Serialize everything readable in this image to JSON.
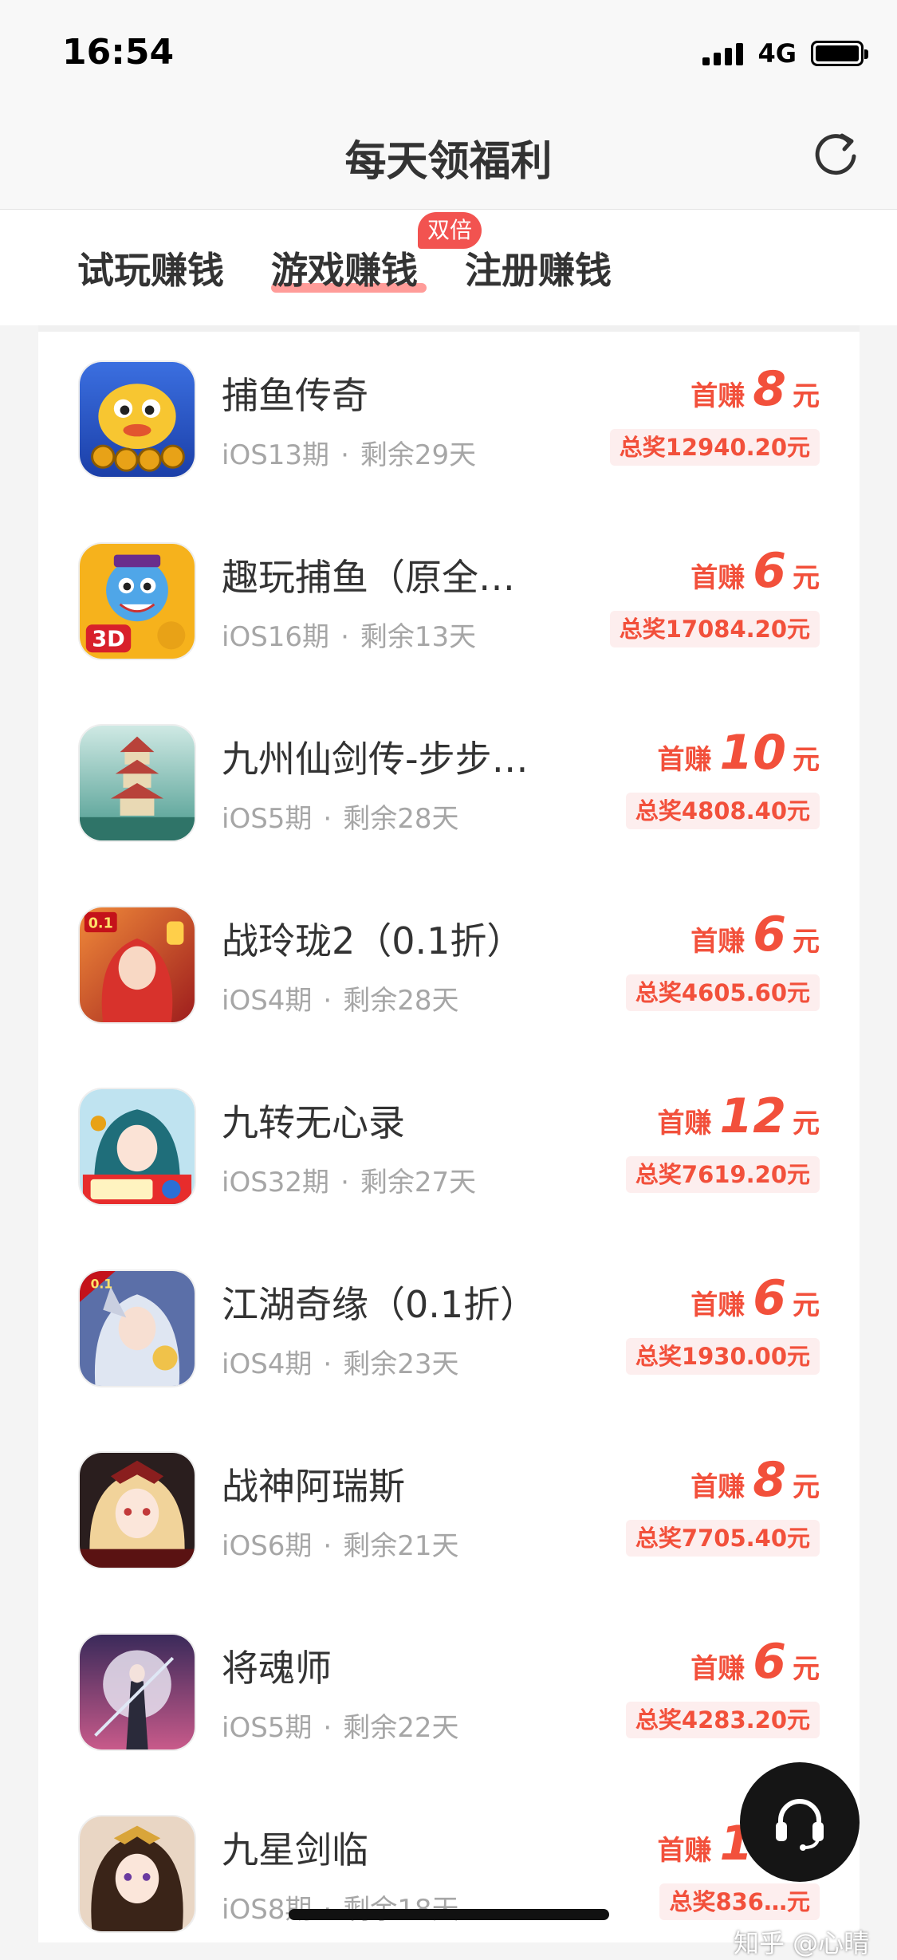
{
  "status_bar": {
    "time": "16:54",
    "network": "4G"
  },
  "nav": {
    "title": "每天领福利",
    "refresh_icon": "refresh-icon"
  },
  "tabs": [
    {
      "label": "试玩赚钱",
      "active": false
    },
    {
      "label": "游戏赚钱",
      "active": true,
      "badge": "双倍"
    },
    {
      "label": "注册赚钱",
      "active": false
    }
  ],
  "accent_color": "#f2503b",
  "list": [
    {
      "name": "捕鱼传奇",
      "period": "iOS13期",
      "remaining": "剩余29天",
      "first_label": "首赚",
      "first_amount": "8",
      "unit": "元",
      "total": "总奖12940.20元"
    },
    {
      "name": "趣玩捕鱼（原全…",
      "period": "iOS16期",
      "remaining": "剩余13天",
      "first_label": "首赚",
      "first_amount": "6",
      "unit": "元",
      "total": "总奖17084.20元"
    },
    {
      "name": "九州仙剑传-步步…",
      "period": "iOS5期",
      "remaining": "剩余28天",
      "first_label": "首赚",
      "first_amount": "10",
      "unit": "元",
      "total": "总奖4808.40元"
    },
    {
      "name": "战玲珑2（0.1折）",
      "period": "iOS4期",
      "remaining": "剩余28天",
      "first_label": "首赚",
      "first_amount": "6",
      "unit": "元",
      "total": "总奖4605.60元"
    },
    {
      "name": "九转无心录",
      "period": "iOS32期",
      "remaining": "剩余27天",
      "first_label": "首赚",
      "first_amount": "12",
      "unit": "元",
      "total": "总奖7619.20元"
    },
    {
      "name": "江湖奇缘（0.1折）",
      "period": "iOS4期",
      "remaining": "剩余23天",
      "first_label": "首赚",
      "first_amount": "6",
      "unit": "元",
      "total": "总奖1930.00元"
    },
    {
      "name": "战神阿瑞斯",
      "period": "iOS6期",
      "remaining": "剩余21天",
      "first_label": "首赚",
      "first_amount": "8",
      "unit": "元",
      "total": "总奖7705.40元"
    },
    {
      "name": "将魂师",
      "period": "iOS5期",
      "remaining": "剩余22天",
      "first_label": "首赚",
      "first_amount": "6",
      "unit": "元",
      "total": "总奖4283.20元"
    },
    {
      "name": "九星剑临",
      "period": "iOS8期",
      "remaining": "剩余18天",
      "first_label": "首赚",
      "first_amount": "10",
      "unit": "元",
      "total": "总奖836…元"
    }
  ],
  "service_button_icon": "headset-icon",
  "watermark": "知乎 @心晴"
}
